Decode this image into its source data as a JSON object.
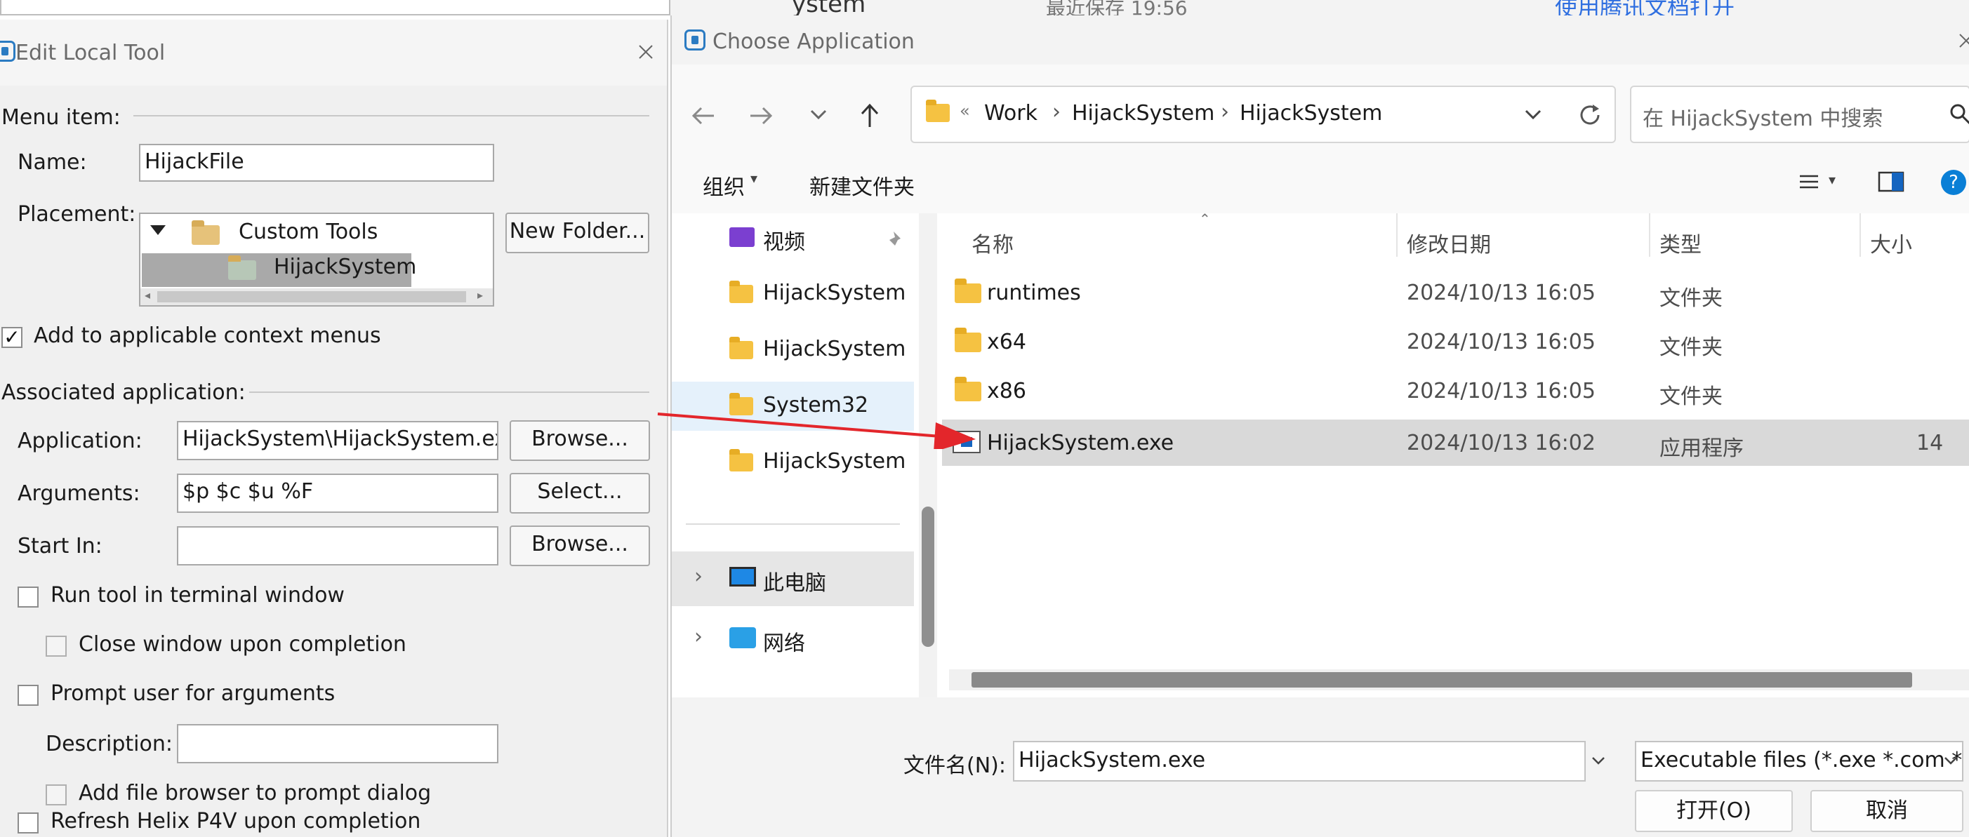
{
  "background_app": {
    "title_fragment": "ystem",
    "save_status": "最近保存 19:56",
    "open_in_tencent_docs": "使用腾讯文档打开"
  },
  "edit_tool_dialog": {
    "title": "Edit Local Tool",
    "menu_item_section": "Menu item:",
    "name_label": "Name:",
    "name_value": "HijackFile",
    "placement_label": "Placement:",
    "placement_tree": [
      "Custom Tools",
      "HijackSystem"
    ],
    "new_folder_button": "New Folder...",
    "add_context_menus_label": "Add to applicable context menus",
    "add_context_menus_checked": true,
    "associated_app_section": "Associated application:",
    "application_label": "Application:",
    "application_value": "HijackSystem\\HijackSystem.exe",
    "browse_button": "Browse...",
    "arguments_label": "Arguments:",
    "arguments_value": "$p $c $u %F",
    "select_button": "Select...",
    "start_in_label": "Start In:",
    "start_in_value": "",
    "browse_button_2": "Browse...",
    "run_in_terminal_label": "Run tool in terminal window",
    "close_window_label": "Close window upon completion",
    "prompt_args_label": "Prompt user for arguments",
    "description_label": "Description:",
    "description_value": "",
    "add_file_browser_label": "Add file browser to prompt dialog",
    "refresh_label": "Refresh Helix P4V upon completion"
  },
  "choose_app_dialog": {
    "title": "Choose Application",
    "breadcrumb": [
      "Work",
      "HijackSystem",
      "HijackSystem"
    ],
    "breadcrumb_overflow": "«",
    "search_placeholder": "在 HijackSystem 中搜索",
    "organize_label": "组织",
    "new_folder_label": "新建文件夹",
    "nav_items": [
      "视频",
      "HijackSystem",
      "HijackSystem",
      "System32",
      "HijackSystem",
      "此电脑",
      "网络"
    ],
    "columns": [
      "名称",
      "修改日期",
      "类型",
      "大小"
    ],
    "files": [
      {
        "name": "runtimes",
        "date": "2024/10/13 16:05",
        "type": "文件夹",
        "size": ""
      },
      {
        "name": "x64",
        "date": "2024/10/13 16:05",
        "type": "文件夹",
        "size": ""
      },
      {
        "name": "x86",
        "date": "2024/10/13 16:05",
        "type": "文件夹",
        "size": ""
      },
      {
        "name": "HijackSystem.exe",
        "date": "2024/10/13 16:02",
        "type": "应用程序",
        "size": "14"
      }
    ],
    "filename_label": "文件名(N):",
    "filename_value": "HijackSystem.exe",
    "filter_value": "Executable files (*.exe *.com *",
    "open_button": "打开(O)",
    "cancel_button": "取消"
  },
  "colors": {
    "annotation_arrow": "#e3262b",
    "selection_gray": "#d9d9d9",
    "accent_blue": "#0a7fd6"
  }
}
